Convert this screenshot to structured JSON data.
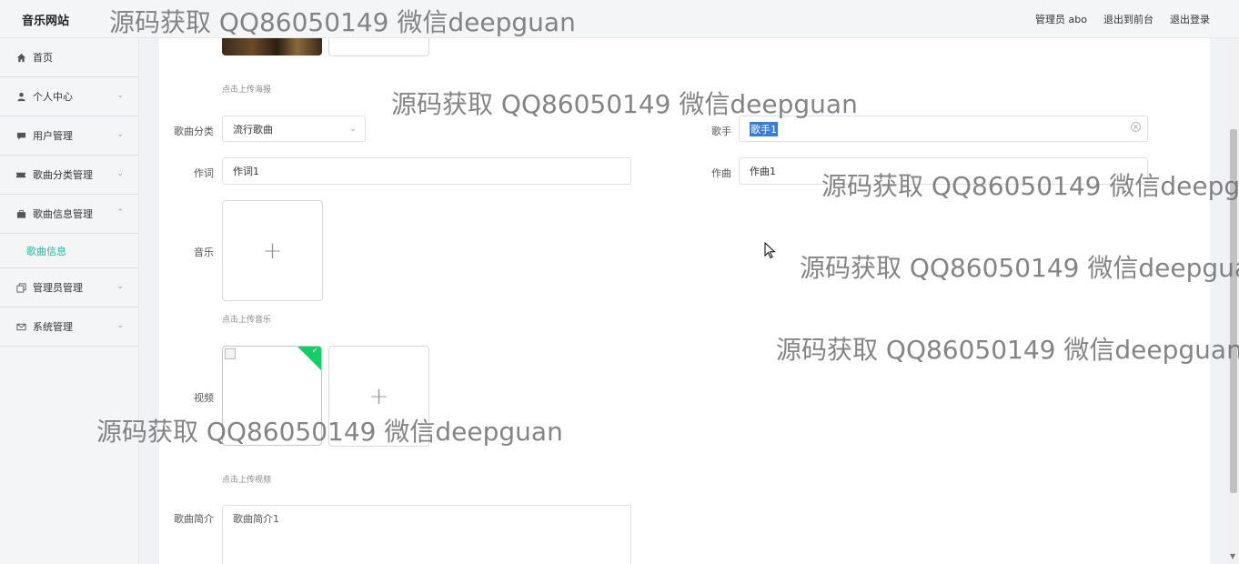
{
  "header": {
    "brand": "音乐网站",
    "user_label": "管理员 abo",
    "to_front_label": "退出到前台",
    "logout_label": "退出登录"
  },
  "sidebar": {
    "items": [
      {
        "label": "首页",
        "icon": "home-icon"
      },
      {
        "label": "个人中心",
        "icon": "user-icon"
      },
      {
        "label": "用户管理",
        "icon": "chat-icon"
      },
      {
        "label": "歌曲分类管理",
        "icon": "ticket-icon"
      },
      {
        "label": "歌曲信息管理",
        "icon": "briefcase-icon"
      },
      {
        "label": "管理员管理",
        "icon": "copy-icon"
      },
      {
        "label": "系统管理",
        "icon": "mail-icon"
      }
    ],
    "active_sub": "歌曲信息"
  },
  "form": {
    "poster_tip": "点击上传海报",
    "category_label": "歌曲分类",
    "category_value": "流行歌曲",
    "singer_label": "歌手",
    "singer_value": "歌手1",
    "lyricist_label": "作词",
    "lyricist_value": "作词1",
    "composer_label": "作曲",
    "composer_value": "作曲1",
    "music_label": "音乐",
    "music_tip": "点击上传音乐",
    "video_label": "视频",
    "video_tip": "点击上传视频",
    "intro_label": "歌曲简介",
    "intro_value": "歌曲简介1"
  },
  "watermark": {
    "text": "源码获取 QQ86050149 微信deepguan"
  },
  "colors": {
    "accent": "#1abc9c",
    "success": "#13ce66",
    "selection": "#3a7bd5"
  }
}
